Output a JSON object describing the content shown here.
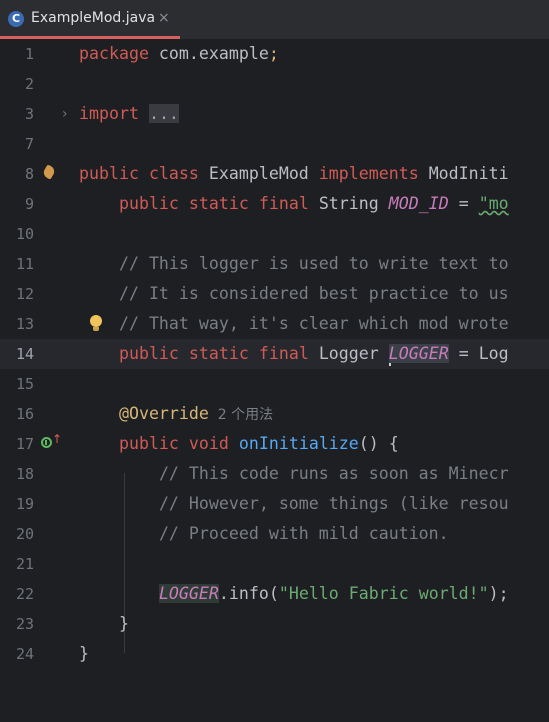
{
  "tab": {
    "icon_letter": "C",
    "file_name": "ExampleMod.java",
    "close_glyph": "×"
  },
  "lines": {
    "l1": {
      "num": "1",
      "t1": "package",
      "t2": " com.example",
      "t3": ";"
    },
    "l2": {
      "num": "2"
    },
    "l3": {
      "num": "3",
      "t1": "import",
      "t2": " ",
      "t3": "...",
      "fold_arrow": "›"
    },
    "l7": {
      "num": "7"
    },
    "l8": {
      "num": "8",
      "t1": "public",
      "t2": " ",
      "t3": "class",
      "t4": " ExampleMod ",
      "t5": "implements",
      "t6": " ModIniti"
    },
    "l9": {
      "num": "9",
      "t1": "    ",
      "t2": "public",
      "t3": " ",
      "t4": "static",
      "t5": " ",
      "t6": "final",
      "t7": " String ",
      "t8": "MOD_ID",
      "t9": " = ",
      "t10": "\"mo"
    },
    "l10": {
      "num": "10"
    },
    "l11": {
      "num": "11",
      "t1": "    ",
      "t2": "// This logger is used to write text to"
    },
    "l12": {
      "num": "12",
      "t1": "    ",
      "t2": "// It is considered best practice to us"
    },
    "l13": {
      "num": "13",
      "t1": "    ",
      "t2": "// That way, it's clear which mod wrote"
    },
    "l14": {
      "num": "14",
      "t1": "    ",
      "t2": "public",
      "t3": " ",
      "t4": "static",
      "t5": " ",
      "t6": "final",
      "t7": " Logger ",
      "t8": "LOGGER",
      "t9": " = Log"
    },
    "l15": {
      "num": "15"
    },
    "l16": {
      "num": "16",
      "t1": "    ",
      "t2": "@Override",
      "t3": "  2 个用法"
    },
    "l17": {
      "num": "17",
      "t1": "    ",
      "t2": "public",
      "t3": " ",
      "t4": "void",
      "t5": " ",
      "t6": "onInitialize",
      "t7": "() {",
      "override_glyph": "↑"
    },
    "l18": {
      "num": "18",
      "t1": "        ",
      "t2": "// This code runs as soon as Minecr"
    },
    "l19": {
      "num": "19",
      "t1": "        ",
      "t2": "// However, some things (like resou"
    },
    "l20": {
      "num": "20",
      "t1": "        ",
      "t2": "// Proceed with mild caution."
    },
    "l21": {
      "num": "21"
    },
    "l22": {
      "num": "22",
      "t1": "        ",
      "t2": "LOGGER",
      "t3": ".info(",
      "t4": "\"Hello Fabric world!\"",
      "t5": ");"
    },
    "l23": {
      "num": "23",
      "t1": "    ",
      "t2": "}"
    },
    "l24": {
      "num": "24",
      "t1": "",
      "t2": "}"
    }
  },
  "colors": {
    "keyword": "#cf5b56",
    "annotation": "#d5b778",
    "method": "#56a8f5",
    "constant": "#c77dbb",
    "comment": "#7a7e85",
    "string": "#6aab73",
    "tab_accent": "#d75f5f"
  },
  "icons": {
    "file": "java-class-icon",
    "bulb": "lightbulb-icon",
    "implements": "implementation-icon",
    "entrypoint": "fabric-entrypoint-icon"
  }
}
